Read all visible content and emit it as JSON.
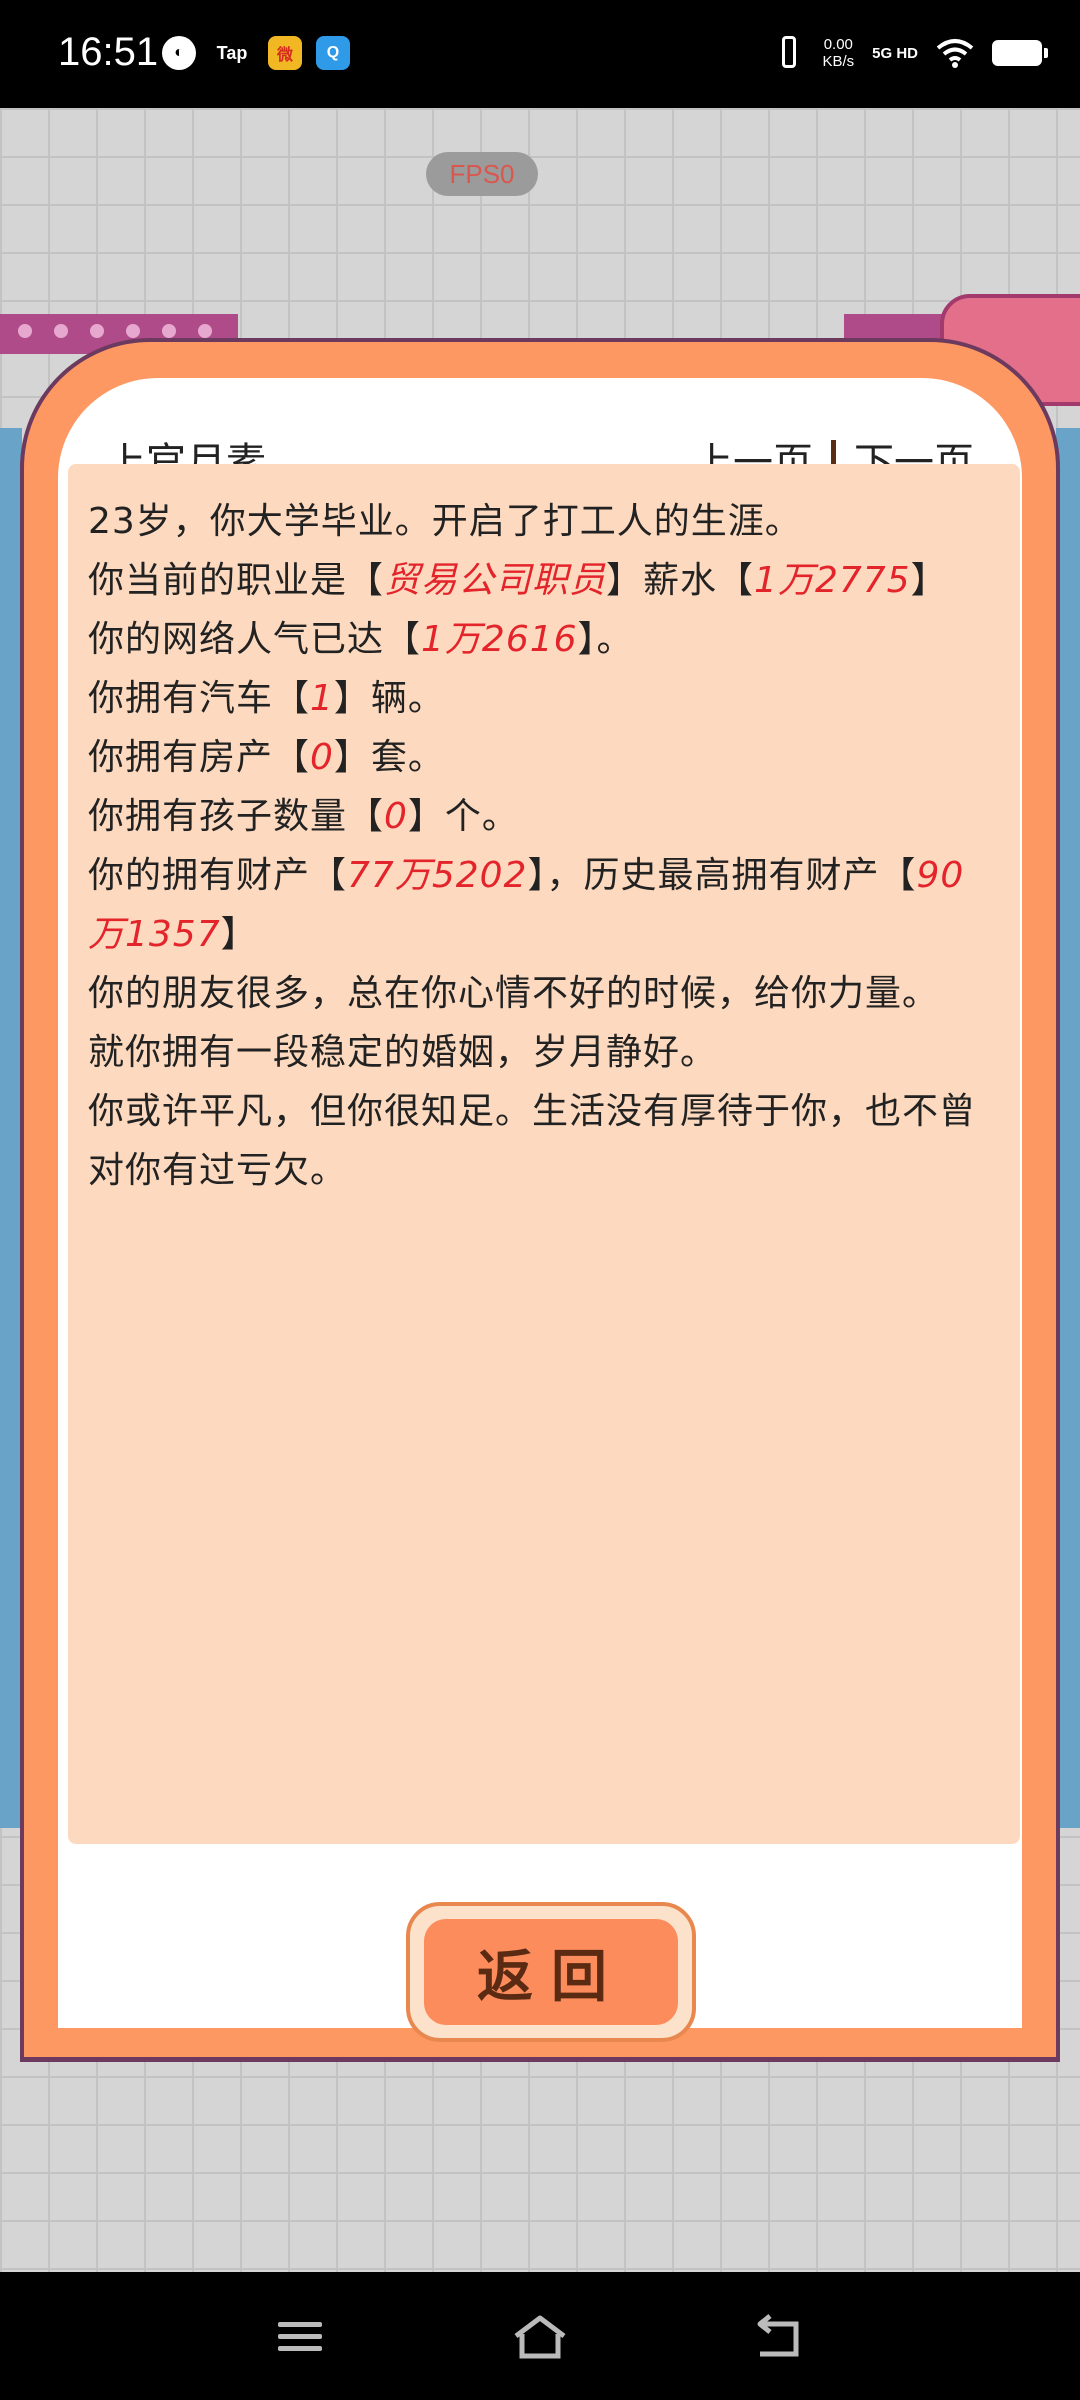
{
  "status_bar": {
    "time": "16:51",
    "tap_label": "Tap",
    "weibo_label": "微",
    "q_label": "Q",
    "net_speed_value": "0.00",
    "net_speed_unit": "KB/s",
    "network_type": "5G HD"
  },
  "game": {
    "fps_label": "FPS0"
  },
  "modal": {
    "character_name": "上官月素",
    "prev_page": "上一页",
    "next_page": "下一页",
    "return_button": "返回",
    "lines": [
      {
        "segments": [
          {
            "text": "23岁，你大学毕业。开启了打工人的生涯。",
            "hl": false
          }
        ]
      },
      {
        "segments": [
          {
            "text": "你当前的职业是【",
            "hl": false
          },
          {
            "text": "贸易公司职员",
            "hl": true
          },
          {
            "text": "】薪水【",
            "hl": false
          },
          {
            "text": "1万2775",
            "hl": true
          },
          {
            "text": "】",
            "hl": false
          }
        ]
      },
      {
        "segments": [
          {
            "text": "你的网络人气已达【",
            "hl": false
          },
          {
            "text": "1万2616",
            "hl": true
          },
          {
            "text": "】。",
            "hl": false
          }
        ]
      },
      {
        "segments": [
          {
            "text": "你拥有汽车【",
            "hl": false
          },
          {
            "text": "1",
            "hl": true
          },
          {
            "text": "】辆。",
            "hl": false
          }
        ]
      },
      {
        "segments": [
          {
            "text": "你拥有房产【",
            "hl": false
          },
          {
            "text": "0",
            "hl": true
          },
          {
            "text": "】套。",
            "hl": false
          }
        ]
      },
      {
        "segments": [
          {
            "text": "你拥有孩子数量【",
            "hl": false
          },
          {
            "text": "0",
            "hl": true
          },
          {
            "text": "】个。",
            "hl": false
          }
        ]
      },
      {
        "segments": [
          {
            "text": "你的拥有财产【",
            "hl": false
          },
          {
            "text": "77万5202",
            "hl": true
          },
          {
            "text": "】，历史最高拥有财产【",
            "hl": false
          },
          {
            "text": "90万1357",
            "hl": true
          },
          {
            "text": "】",
            "hl": false
          }
        ]
      },
      {
        "segments": [
          {
            "text": "你的朋友很多，总在你心情不好的时候，给你力量。",
            "hl": false
          }
        ]
      },
      {
        "segments": [
          {
            "text": "就你拥有一段稳定的婚姻，岁月静好。",
            "hl": false
          }
        ]
      },
      {
        "segments": [
          {
            "text": "你或许平凡，但你很知足。生活没有厚待于你，也不曾对你有过亏欠。",
            "hl": false
          }
        ]
      }
    ]
  },
  "nav_icons": [
    "menu-icon",
    "home-icon",
    "back-icon"
  ]
}
